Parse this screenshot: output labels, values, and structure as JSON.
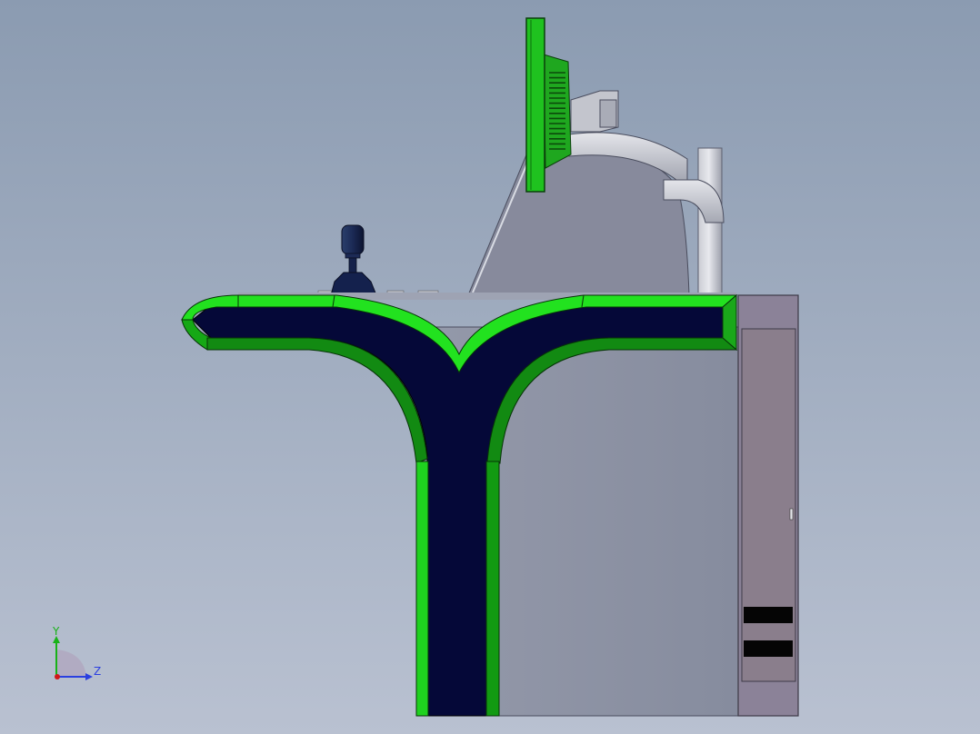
{
  "viewport": {
    "background_top": "#8b9bb1",
    "background_bottom": "#b9c1d1"
  },
  "model": {
    "accent_color": "#1ed31e",
    "trim_dark_color": "#0f5e12",
    "panel_color": "#05073a",
    "body_color": "#8d93a4",
    "cabinet_color": "#8c8191"
  },
  "triad": {
    "y_label": "Y",
    "z_label": "Z",
    "y_color": "#18b218",
    "z_color": "#2b3fe0",
    "x_color": "#d01818"
  }
}
